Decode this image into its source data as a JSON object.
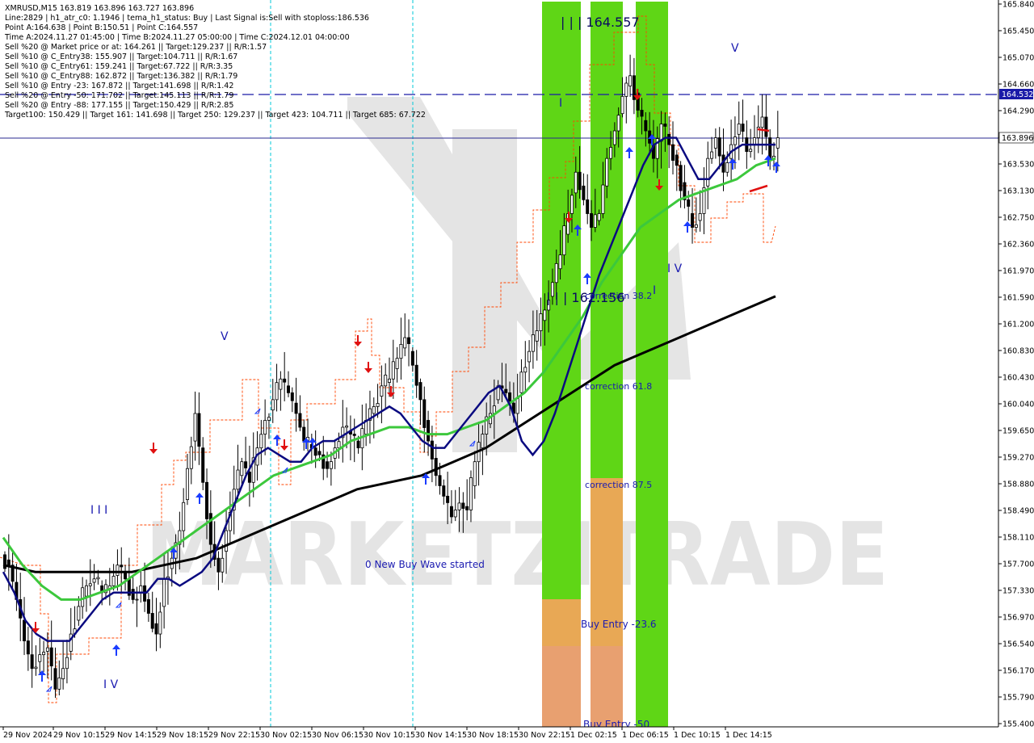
{
  "header": {
    "lines": [
      "XMRUSD,M15  163.819 163.896 163.727 163.896",
      "Line:2829  |  h1_atr_c0: 1.1946  |  tema_h1_status: Buy  |  Last Signal is:Sell with stoploss:186.536",
      "Point A:164.638  |  Point B:150.51  |  Point C:164.557",
      "Time A:2024.11.27 01:45:00  |  Time B:2024.11.27 05:00:00  |  Time C:2024.12.01 04:00:00",
      "Sell %20 @ Market price or at: 164.261  ||  Target:129.237  ||  R/R:1.57",
      "Sell %10 @ C_Entry38: 155.907  ||  Target:104.711  ||  R/R:1.67",
      "Sell %10 @ C_Entry61: 159.241  ||  Target:67.722  ||  R/R:3.35",
      "Sell %10 @ C_Entry88: 162.872  ||  Target:136.382  ||  R/R:1.79",
      "Sell %10 @ Entry -23: 167.872  ||  Target:141.698  ||  R/R:1.42",
      "Sell %20 @ Entry -50: 171.702  ||  Target:145.113  ||  R/R:1.79",
      "Sell %20 @ Entry -88: 177.155  ||  Target:150.429  ||  R/R:2.85",
      "Target100: 150.429  ||  Target 161: 141.698  ||  Target 250: 129.237  ||  Target 423: 104.711  ||  Target 685: 67.722"
    ]
  },
  "annotations": {
    "point_c_label": "| | | 164.557",
    "point_b_label": "| | | 162.156",
    "correction_382": "correction 38.2",
    "correction_618": "correction 61.8",
    "correction_875": "correction 87.5",
    "buy_entry_236": "Buy Entry -23.6",
    "buy_entry_50": "Buy Entry -50",
    "new_wave": "0 New Buy Wave started",
    "wave_v_top": "V",
    "wave_v_mid": "V",
    "wave_iii_left": "I I I",
    "wave_iv_left": "I V",
    "wave_iv_right": "I V",
    "wave_i_mid": "I",
    "wave_i_right": "I",
    "watermark": "MARKETZITRADE"
  },
  "price_labels": {
    "hline_blue": "164.532",
    "current": "163.896"
  },
  "colors": {
    "green_band": "#5fd616",
    "orange_band": "#e0a060",
    "tema_line": "#0a0a80",
    "ma_green": "#3cc83c",
    "ma_black": "#000000",
    "sell_arrow": "#e01010",
    "buy_arrow": "#1a3cff",
    "dashed_red": "#ff4500",
    "cyan_vline": "#00c8d8"
  },
  "chart_data": {
    "type": "candlestick",
    "symbol": "XMRUSD",
    "timeframe": "M15",
    "ylim": [
      155.4,
      165.84
    ],
    "y_ticks": [
      "165.840",
      "165.450",
      "165.070",
      "164.660",
      "164.290",
      "163.920",
      "163.530",
      "163.130",
      "162.750",
      "162.360",
      "161.970",
      "161.590",
      "161.200",
      "160.830",
      "160.430",
      "160.040",
      "159.650",
      "159.270",
      "158.880",
      "158.490",
      "158.110",
      "157.700",
      "157.330",
      "156.970",
      "156.540",
      "156.170",
      "155.790",
      "155.400"
    ],
    "x_ticks": [
      "29 Nov 2024",
      "29 Nov 10:15",
      "29 Nov 14:15",
      "29 Nov 18:15",
      "29 Nov 22:15",
      "30 Nov 02:15",
      "30 Nov 06:15",
      "30 Nov 10:15",
      "30 Nov 14:15",
      "30 Nov 18:15",
      "30 Nov 22:15",
      "1 Dec 02:15",
      "1 Dec 06:15",
      "1 Dec 10:15",
      "1 Dec 14:15"
    ],
    "hlines": [
      164.532,
      163.896
    ],
    "series": [
      {
        "name": "close",
        "values": [
          157.7,
          157.2,
          156.6,
          156.2,
          156.4,
          156.5,
          155.9,
          156.2,
          156.7,
          157.1,
          157.4,
          157.5,
          157.3,
          157.4,
          157.7,
          157.5,
          157.2,
          157.4,
          157.0,
          156.7,
          157.5,
          157.8,
          158.2,
          159.1,
          159.9,
          158.9,
          158.0,
          157.6,
          158.2,
          158.8,
          159.2,
          158.9,
          159.4,
          159.8,
          160.1,
          160.4,
          160.2,
          159.9,
          159.5,
          159.4,
          159.3,
          159.1,
          159.4,
          159.7,
          159.6,
          159.4,
          159.8,
          160.0,
          160.3,
          160.4,
          160.7,
          161.0,
          160.6,
          160.1,
          159.5,
          159.0,
          158.7,
          158.4,
          158.6,
          158.5,
          159.2,
          159.6,
          159.9,
          160.3,
          160.2,
          159.9,
          160.5,
          160.8,
          161.1,
          161.4,
          161.8,
          162.2,
          162.8,
          163.4,
          163.0,
          162.6,
          162.8,
          163.6,
          164.0,
          164.5,
          164.8,
          164.3,
          164.0,
          163.6,
          164.1,
          163.8,
          163.5,
          163.0,
          162.6,
          162.8,
          163.6,
          163.9,
          163.4,
          163.8,
          164.1,
          163.7,
          163.9,
          164.2,
          163.6,
          163.9
        ]
      },
      {
        "name": "tema",
        "values": [
          157.6,
          157.3,
          156.9,
          156.7,
          156.6,
          156.6,
          156.6,
          156.8,
          157.0,
          157.2,
          157.3,
          157.3,
          157.3,
          157.3,
          157.5,
          157.5,
          157.4,
          157.5,
          157.6,
          157.8,
          158.2,
          158.6,
          159.0,
          159.3,
          159.4,
          159.3,
          159.2,
          159.2,
          159.4,
          159.5,
          159.5,
          159.6,
          159.7,
          159.8,
          159.9,
          160.0,
          159.9,
          159.7,
          159.5,
          159.4,
          159.4,
          159.6,
          159.8,
          160.0,
          160.2,
          160.3,
          160.0,
          159.5,
          159.3,
          159.5,
          159.9,
          160.4,
          160.9,
          161.4,
          161.9,
          162.3,
          162.7,
          163.1,
          163.5,
          163.8,
          163.9,
          163.9,
          163.6,
          163.3,
          163.3,
          163.5,
          163.7,
          163.8,
          163.8,
          163.8,
          163.8
        ]
      },
      {
        "name": "ma_green",
        "values": [
          158.1,
          157.7,
          157.4,
          157.2,
          157.2,
          157.3,
          157.4,
          157.6,
          157.8,
          158.0,
          158.2,
          158.4,
          158.6,
          158.8,
          159.0,
          159.1,
          159.2,
          159.3,
          159.5,
          159.6,
          159.7,
          159.7,
          159.6,
          159.6,
          159.7,
          159.8,
          160.0,
          160.2,
          160.5,
          160.9,
          161.3,
          161.8,
          162.2,
          162.6,
          162.8,
          163.0,
          163.1,
          163.2,
          163.3,
          163.5,
          163.6
        ]
      },
      {
        "name": "ma_black",
        "values": [
          157.7,
          157.6,
          157.6,
          157.6,
          157.6,
          157.7,
          157.8,
          158.0,
          158.2,
          158.4,
          158.6,
          158.8,
          158.9,
          159.0,
          159.2,
          159.4,
          159.7,
          160.0,
          160.3,
          160.6,
          160.8,
          161.0,
          161.2,
          161.4,
          161.6
        ]
      }
    ]
  }
}
